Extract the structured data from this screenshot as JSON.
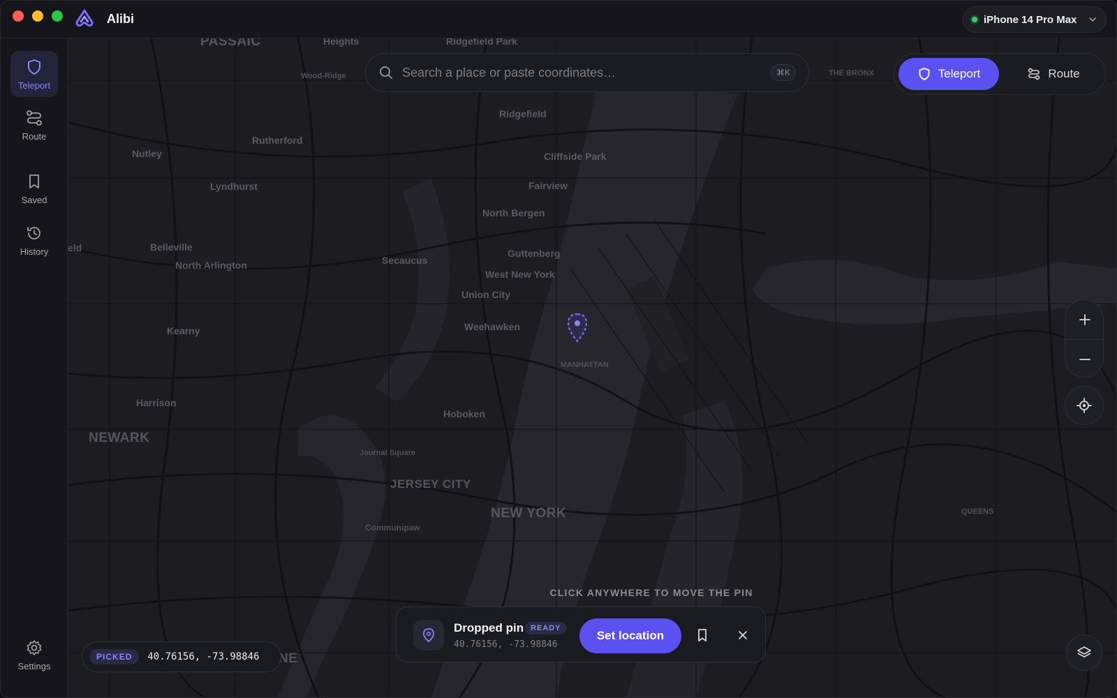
{
  "app": {
    "title": "Alibi",
    "device": "iPhone 14 Pro Max"
  },
  "sidebar": {
    "items": [
      {
        "label": "Teleport",
        "icon": "shield-icon",
        "active": true
      },
      {
        "label": "Route",
        "icon": "route-icon"
      },
      {
        "label": "Saved",
        "icon": "bookmark-icon"
      },
      {
        "label": "History",
        "icon": "history-icon"
      }
    ],
    "settings_label": "Settings"
  },
  "search": {
    "placeholder": "Search a place or paste coordinates…",
    "shortcut": "⌘K"
  },
  "modes": {
    "teleport_label": "Teleport",
    "route_label": "Route"
  },
  "map": {
    "places": [
      "PASSAIC",
      "Heights",
      "Ridgefield Park",
      "Wood-Ridge",
      "THE BRONX",
      "Ridgefield",
      "Rutherford",
      "Cliffside Park",
      "Nutley",
      "Lyndhurst",
      "Fairview",
      "North Bergen",
      "eld",
      "Belleville",
      "Guttenberg",
      "Secaucus",
      "North Arlington",
      "West New York",
      "Union City",
      "Kearny",
      "Weehawken",
      "MANHATTAN",
      "Harrison",
      "Hoboken",
      "NEWARK",
      "Journal Square",
      "JERSEY CITY",
      "NEW YORK",
      "QUEENS",
      "Communipaw",
      "NE"
    ],
    "hint": "CLICK ANYWHERE TO MOVE THE PIN"
  },
  "dropped": {
    "title": "Dropped pin",
    "badge": "READY",
    "coords": "40.76156, -73.98846",
    "set_label": "Set location"
  },
  "picked": {
    "tag": "PICKED",
    "value": "40.76156, -73.98846"
  },
  "colors": {
    "accent": "#5b51f0",
    "accent_text": "#8d86ff",
    "status_ok": "#2ecc71"
  }
}
